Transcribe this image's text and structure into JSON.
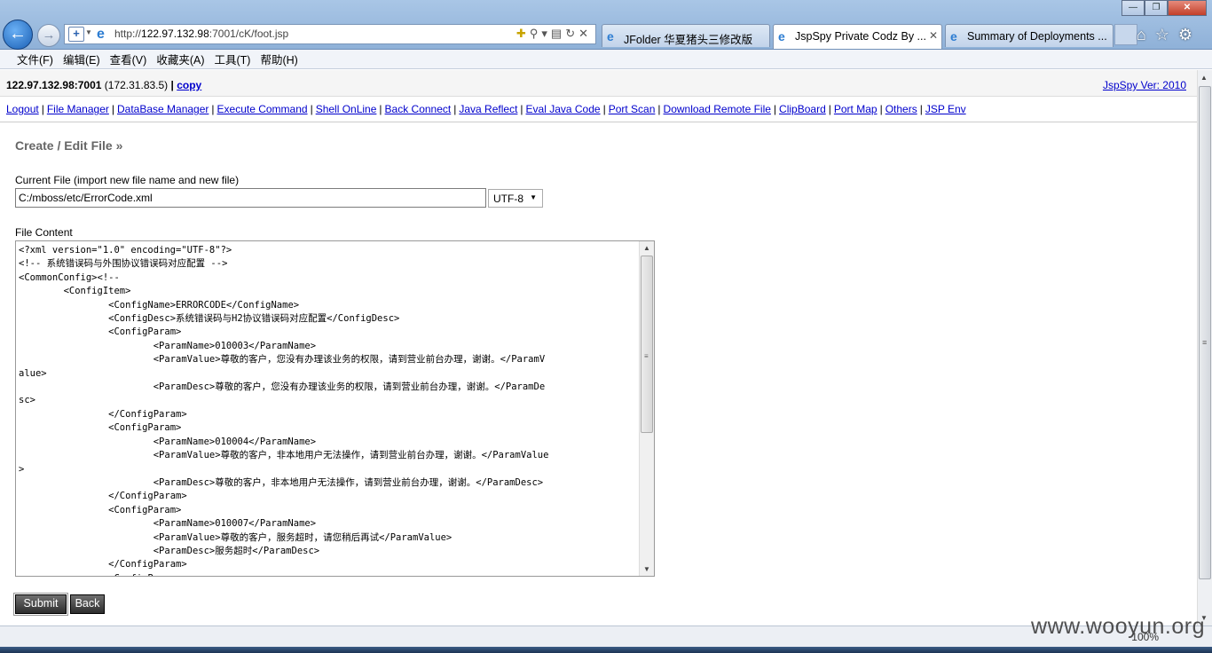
{
  "browser": {
    "url_prefix": "http://",
    "url_host": "122.97.132.98",
    "url_path": ":7001/cK/foot.jsp",
    "tabs": [
      {
        "title": "JFolder 华夏猪头三修改版",
        "active": false
      },
      {
        "title": "JspSpy Private Codz By ...",
        "active": true
      },
      {
        "title": "Summary of Deployments ...",
        "active": false
      }
    ],
    "menu": [
      "文件(F)",
      "编辑(E)",
      "查看(V)",
      "收藏夹(A)",
      "工具(T)",
      "帮助(H)"
    ],
    "zoom": "100%"
  },
  "header": {
    "host": "122.97.132.98:7001",
    "ip": "(172.31.83.5)",
    "separator": "|",
    "copy_label": "copy",
    "version": "JspSpy Ver: 2010"
  },
  "nav_links": [
    "Logout",
    "File Manager",
    "DataBase Manager",
    "Execute Command",
    "Shell OnLine",
    "Back Connect",
    "Java Reflect",
    "Eval Java Code",
    "Port Scan",
    "Download Remote File",
    "ClipBoard",
    "Port Map",
    "Others",
    "JSP Env"
  ],
  "form": {
    "title": "Create / Edit File »",
    "current_file_label": "Current File (import new file name and new file)",
    "current_file_value": "C:/mboss/etc/ErrorCode.xml",
    "encoding": "UTF-8",
    "content_label": "File Content",
    "content": "<?xml version=\"1.0\" encoding=\"UTF-8\"?>\n<!-- 系统错误码与外围协议错误码对应配置 -->\n<CommonConfig><!--\n\t<ConfigItem>\n\t\t<ConfigName>ERRORCODE</ConfigName>\n\t\t<ConfigDesc>系统错误码与H2协议错误码对应配置</ConfigDesc>\n\t\t<ConfigParam>\n\t\t\t<ParamName>010003</ParamName>\n\t\t\t<ParamValue>尊敬的客户，您没有办理该业务的权限，请到营业前台办理，谢谢。</ParamV\nalue>\n\t\t\t<ParamDesc>尊敬的客户，您没有办理该业务的权限，请到营业前台办理，谢谢。</ParamDe\nsc>\n\t\t</ConfigParam>\n\t\t<ConfigParam>\n\t\t\t<ParamName>010004</ParamName>\n\t\t\t<ParamValue>尊敬的客户，非本地用户无法操作，请到营业前台办理，谢谢。</ParamValue\n>\n\t\t\t<ParamDesc>尊敬的客户，非本地用户无法操作，请到营业前台办理，谢谢。</ParamDesc>\n\t\t</ConfigParam>\n\t\t<ConfigParam>\n\t\t\t<ParamName>010007</ParamName>\n\t\t\t<ParamValue>尊敬的客户，服务超时，请您稍后再试</ParamValue>\n\t\t\t<ParamDesc>服务超时</ParamDesc>\n\t\t</ConfigParam>\n\t\t<ConfigParam>",
    "submit_label": "Submit",
    "back_label": "Back"
  },
  "watermark": "www.wooyun.org"
}
